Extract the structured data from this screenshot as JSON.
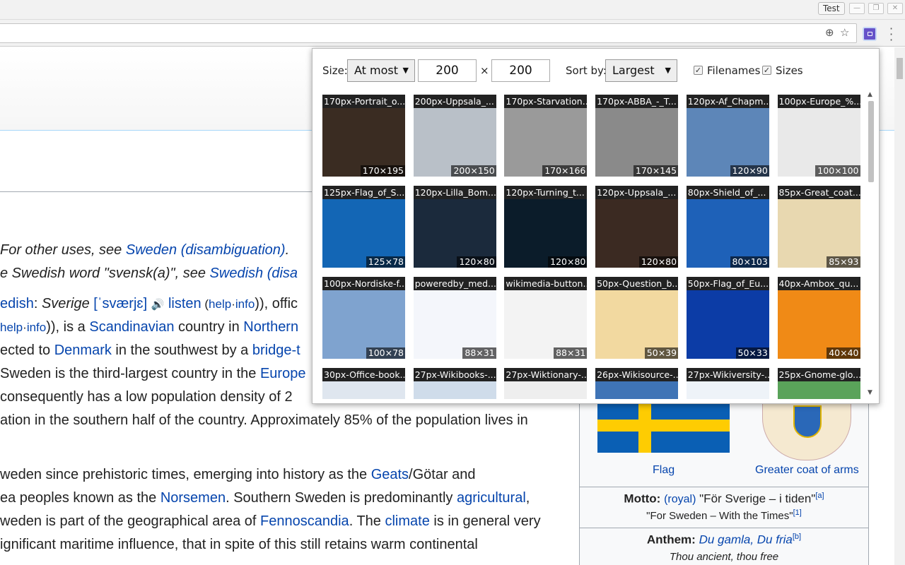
{
  "browser": {
    "profile_label": "Test",
    "window_buttons": [
      "—",
      "❐",
      "✕"
    ],
    "icons": [
      "zoom-icon",
      "bookmark-star-icon",
      "image-extension-icon",
      "menu-icon"
    ]
  },
  "wiki": {
    "hatnote1": [
      "For other uses, see ",
      "Sweden (disambiguation)",
      "."
    ],
    "hatnote2": [
      "e Swedish word \"svensk(a)\", see ",
      "Swedish (disa"
    ],
    "l1": [
      "edish",
      ": ",
      "Sverige",
      " [ˈsværjɛ]",
      "🔊",
      "listen",
      " (",
      "help",
      "·",
      "info",
      ")), offic"
    ],
    "l2": [
      "help",
      "·",
      "info",
      ")), is a ",
      "Scandinavian",
      " country in ",
      "Northern"
    ],
    "l3": [
      "ected to ",
      "Denmark",
      " in the southwest by a ",
      "bridge-t"
    ],
    "l4": [
      "Sweden is the third-largest country in the ",
      "Europe"
    ],
    "l5": " consequently has a low population density of 2",
    "l6": "ation in the southern half of the country. Approximately 85% of the population lives in",
    "l7": [
      "weden since prehistoric times, emerging into history as the ",
      "Geats",
      "/Götar and"
    ],
    "l8": [
      "ea peoples known as the ",
      "Norsemen",
      ". Southern Sweden is predominantly ",
      "agricultural",
      ","
    ],
    "l9": [
      "weden is part of the geographical area of ",
      "Fennoscandia",
      ". The ",
      "climate",
      " is in general very"
    ],
    "l10": "ignificant maritime influence, that in spite of this still retains warm continental",
    "infobox": {
      "flag_caption": "Flag",
      "coa_caption": "Greater coat of arms",
      "motto_label": "Motto:",
      "motto_royal": "(royal)",
      "motto_text": " \"För Sverige – i tiden\"",
      "motto_ref": "[a]",
      "motto_translation": "\"For Sweden – With the Times\"",
      "motto_translation_ref": "[1]",
      "anthem_label": "Anthem:",
      "anthem_name": "Du gamla, Du fria",
      "anthem_ref": "[b]",
      "anthem_translation": "Thou ancient, thou free"
    }
  },
  "popup": {
    "size_label": "Size:",
    "size_mode": "At most",
    "width": "200",
    "times": "×",
    "height": "200",
    "sort_label": "Sort by:",
    "sort_value": "Largest",
    "filenames_label": "Filenames",
    "filenames_checked": true,
    "sizes_label": "Sizes",
    "sizes_checked": true,
    "images": [
      {
        "name": "170px-Portrait_o...",
        "size": "170×195",
        "color": "#3a2c22"
      },
      {
        "name": "200px-Uppsala_...",
        "size": "200×150",
        "color": "#b9c0c8"
      },
      {
        "name": "170px-Starvation...",
        "size": "170×166",
        "color": "#9a9a9a"
      },
      {
        "name": "170px-ABBA_-_T...",
        "size": "170×145",
        "color": "#8a8a8a"
      },
      {
        "name": "120px-Af_Chapm...",
        "size": "120×90",
        "color": "#5d86b8"
      },
      {
        "name": "100px-Europe_%...",
        "size": "100×100",
        "color": "#e9e9e9"
      },
      {
        "name": "125px-Flag_of_S...",
        "size": "125×78",
        "color": "#1366b5"
      },
      {
        "name": "120px-Lilla_Bom...",
        "size": "120×80",
        "color": "#1b2a3c"
      },
      {
        "name": "120px-Turning_t...",
        "size": "120×80",
        "color": "#0b1c2a"
      },
      {
        "name": "120px-Uppsala_...",
        "size": "120×80",
        "color": "#3b2a22"
      },
      {
        "name": "80px-Shield_of_...",
        "size": "80×103",
        "color": "#1e61b8"
      },
      {
        "name": "85px-Great_coat...",
        "size": "85×93",
        "color": "#e8d8b0"
      },
      {
        "name": "100px-Nordiske-f...",
        "size": "100×78",
        "color": "#7fa3cf"
      },
      {
        "name": "poweredby_med...",
        "size": "88×31",
        "color": "#f4f6fb"
      },
      {
        "name": "wikimedia-button...",
        "size": "88×31",
        "color": "#f3f3f3"
      },
      {
        "name": "50px-Question_b...",
        "size": "50×39",
        "color": "#f2d9a0"
      },
      {
        "name": "50px-Flag_of_Eu...",
        "size": "50×33",
        "color": "#0c3ca6"
      },
      {
        "name": "40px-Ambox_qu...",
        "size": "40×40",
        "color": "#f08a16"
      },
      {
        "name": "30px-Office-book...",
        "size": "",
        "color": "#dfe6ef"
      },
      {
        "name": "27px-Wikibooks-...",
        "size": "",
        "color": "#cfdcea"
      },
      {
        "name": "27px-Wiktionary-...",
        "size": "",
        "color": "#eeeeee"
      },
      {
        "name": "26px-Wikisource-...",
        "size": "",
        "color": "#3f74b6"
      },
      {
        "name": "27px-Wikiversity-...",
        "size": "",
        "color": "#eef3f8"
      },
      {
        "name": "25px-Gnome-glo...",
        "size": "",
        "color": "#5aa35a"
      }
    ]
  }
}
